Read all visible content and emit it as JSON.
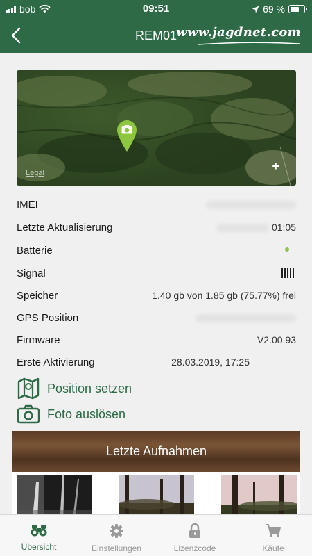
{
  "status_bar": {
    "carrier": "bob",
    "time": "09:51",
    "battery_percent": "69 %",
    "battery_level": 0.69,
    "icons": [
      "signal-icon",
      "wifi-icon",
      "location-arrow-icon",
      "battery-icon"
    ]
  },
  "nav": {
    "title": "REM01",
    "brand": "www.jagdnet.com",
    "back_icon": "chevron-left-icon"
  },
  "map": {
    "legal_label": "Legal",
    "zoom_label": "+",
    "pin_icon": "camera-pin-icon"
  },
  "device_info": [
    {
      "label": "IMEI",
      "value": ""
    },
    {
      "label": "Letzte Aktualisierung",
      "value": "01:05"
    },
    {
      "label": "Batterie",
      "value": ""
    },
    {
      "label": "Signal",
      "value": ""
    },
    {
      "label": "Speicher",
      "value": "1.40 gb von 1.85 gb (75.77%) frei"
    },
    {
      "label": "GPS Position",
      "value": ""
    },
    {
      "label": "Firmware",
      "value": "V2.00.93"
    },
    {
      "label": "Erste Aktivierung",
      "value": "28.03.2019, 17:25"
    }
  ],
  "actions": [
    {
      "label": "Position setzen",
      "icon": "map-icon"
    },
    {
      "label": "Foto auslösen",
      "icon": "camera-icon"
    }
  ],
  "recent": {
    "title": "Letzte Aufnahmen"
  },
  "tabs": [
    {
      "label": "Übersicht",
      "icon": "binoculars-icon",
      "active": true
    },
    {
      "label": "Einstellungen",
      "icon": "gear-icon",
      "active": false
    },
    {
      "label": "Lizenzcode",
      "icon": "lock-icon",
      "active": false
    },
    {
      "label": "Käufe",
      "icon": "cart-icon",
      "active": false
    }
  ],
  "colors": {
    "brand_green": "#2f6a47",
    "battery_dot": "#8dc63f",
    "pin_green": "#8dc63f",
    "tab_inactive": "#9a9a9a"
  }
}
